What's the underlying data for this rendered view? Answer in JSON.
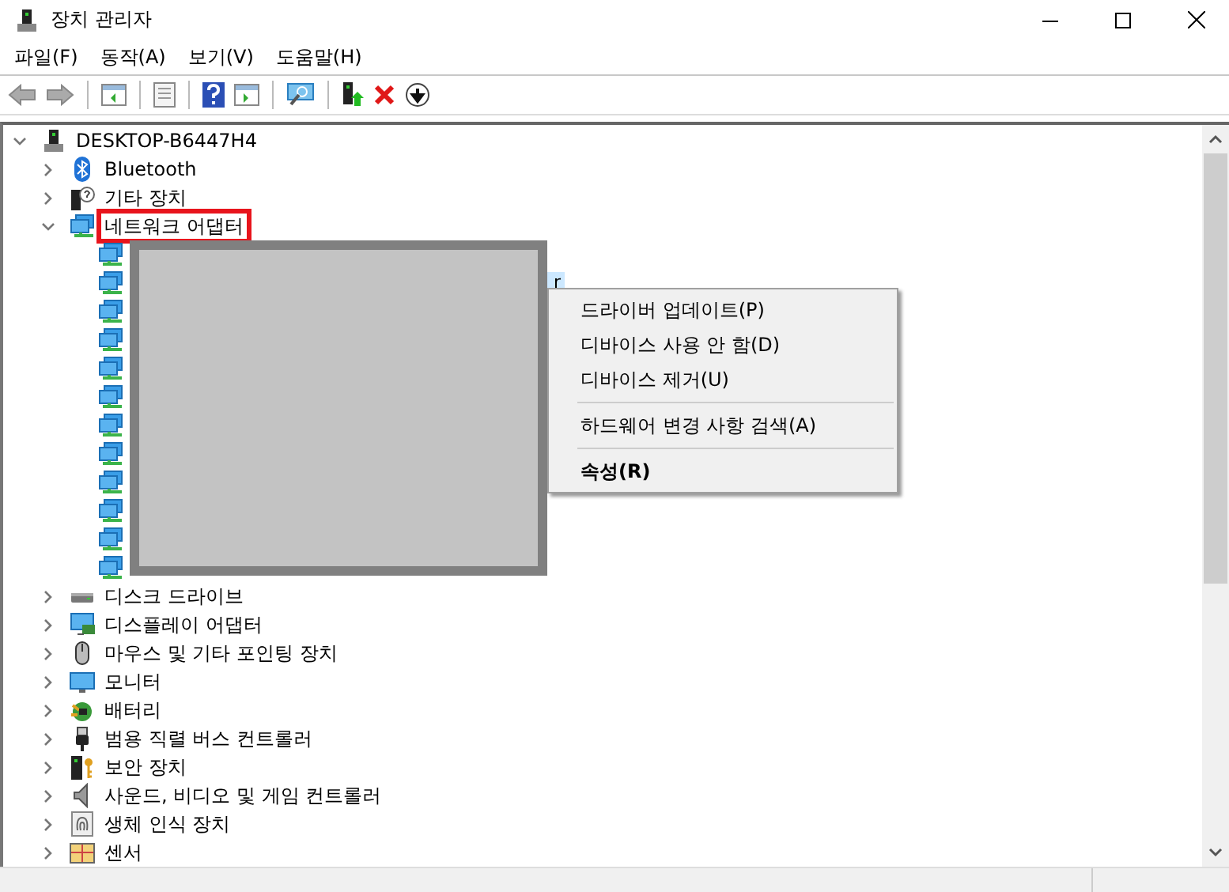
{
  "window": {
    "title": "장치 관리자"
  },
  "menu": [
    "파일(F)",
    "동작(A)",
    "보기(V)",
    "도움말(H)"
  ],
  "tree": {
    "label": "DESKTOP-B6447H4",
    "expanded": true,
    "children": [
      {
        "kind": "bluetooth",
        "label": "Bluetooth",
        "expanded": false
      },
      {
        "kind": "other",
        "label": "기타 장치",
        "expanded": false
      },
      {
        "kind": "network",
        "label": "네트워크 어댑터",
        "expanded": true,
        "children": [
          {
            "kind": "network"
          },
          {
            "kind": "network",
            "label": "r",
            "selected": true
          },
          {
            "kind": "network"
          },
          {
            "kind": "network"
          },
          {
            "kind": "network"
          },
          {
            "kind": "network"
          },
          {
            "kind": "network"
          },
          {
            "kind": "network"
          },
          {
            "kind": "network"
          },
          {
            "kind": "network"
          },
          {
            "kind": "network"
          },
          {
            "kind": "network"
          }
        ]
      },
      {
        "kind": "disk",
        "label": "디스크 드라이브",
        "expanded": false
      },
      {
        "kind": "display",
        "label": "디스플레이 어댑터",
        "expanded": false
      },
      {
        "kind": "mouse",
        "label": "마우스 및 기타 포인팅 장치",
        "expanded": false
      },
      {
        "kind": "monitor",
        "label": "모니터",
        "expanded": false
      },
      {
        "kind": "battery",
        "label": "배터리",
        "expanded": false
      },
      {
        "kind": "usb",
        "label": "범용 직렬 버스 컨트롤러",
        "expanded": false
      },
      {
        "kind": "security",
        "label": "보안 장치",
        "expanded": false
      },
      {
        "kind": "sound",
        "label": "사운드, 비디오 및 게임 컨트롤러",
        "expanded": false
      },
      {
        "kind": "biometric",
        "label": "생체 인식 장치",
        "expanded": false
      },
      {
        "kind": "sensor",
        "label": "센서",
        "expanded": false
      }
    ]
  },
  "context_menu": {
    "items": [
      {
        "kind": "item",
        "label": "드라이버 업데이트(P)",
        "bold": false
      },
      {
        "kind": "item",
        "label": "디바이스 사용 안 함(D)",
        "bold": false
      },
      {
        "kind": "item",
        "label": "디바이스 제거(U)",
        "bold": false
      },
      {
        "kind": "separator"
      },
      {
        "kind": "item",
        "label": "하드웨어 변경 사항 검색(A)",
        "bold": false
      },
      {
        "kind": "separator"
      },
      {
        "kind": "item",
        "label": "속성(R)",
        "bold": true
      }
    ]
  }
}
